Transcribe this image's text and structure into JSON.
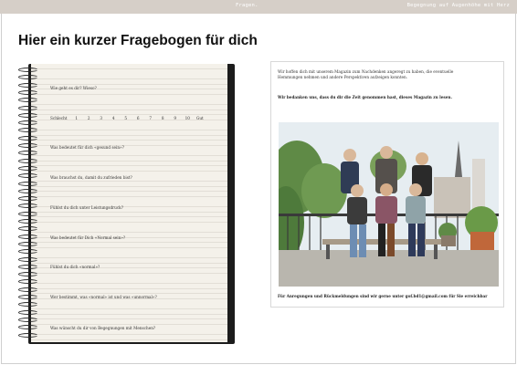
{
  "header": {
    "left_label": "Fragen.",
    "right_label": "Begegnung auf Augenhöhe mit Herz"
  },
  "page": {
    "title": "Hier ein kurzer Fragebogen für dich"
  },
  "questionnaire": {
    "q1": "Wie geht es dir? Wieso?",
    "scale_left": "Schlecht",
    "scale_numbers": [
      "1",
      "2",
      "3",
      "4",
      "5",
      "6",
      "7",
      "8",
      "9",
      "10"
    ],
    "scale_right": "Gut",
    "q2": "Was bedeutet für dich «gesund sein»?",
    "q3": "Was brauchst du, damit du zufrieden bist?",
    "q4": "Fühlst du dich unter Leistungsdruck?",
    "q5": "Was bedeutet für Dich «Normal sein»?",
    "q6": "Fühlst du dich «normal»?",
    "q7": "Wer bestimmt, was «normal» ist und was «unnormal»?",
    "q8": "Was wünscht du dir von Begegnungen mit Menschen?"
  },
  "card": {
    "intro": "Wir hoffen dich mit unserem Magazin zum Nachdenken angeregt zu haben, die eventuelle Hemmungen nehmen und andere Perspektiven aufzeigen konnten.",
    "thanks": "Wir bedanken uns, dass du dir die Zeit genommen hast, dieses Magazin zu lesen.",
    "footer": "Für Anregungen und Rückmeldungen sind wir gerne unter gof.bd1@gmail.com für Sie erreichbar"
  }
}
